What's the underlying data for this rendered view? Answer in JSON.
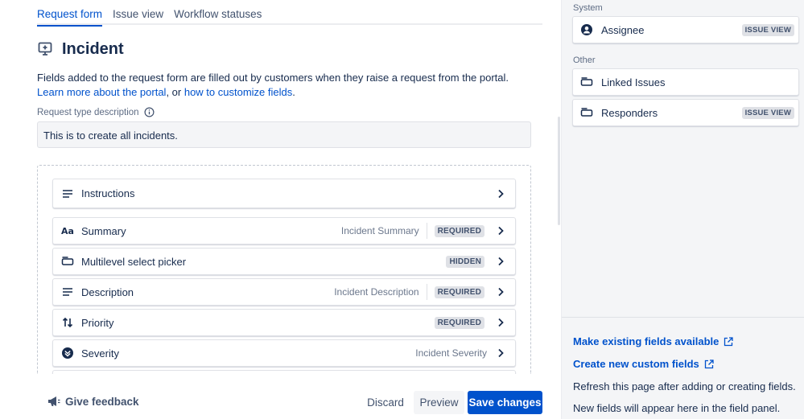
{
  "tabs": [
    {
      "label": "Request form",
      "active": true
    },
    {
      "label": "Issue view",
      "active": false
    },
    {
      "label": "Workflow statuses",
      "active": false
    }
  ],
  "page": {
    "title": "Incident",
    "icon": "monitor-icon",
    "description_text": "Fields added to the request form are filled out by customers when they raise a request from the portal. ",
    "link1": "Learn more about the portal",
    "desc_mid": ", or ",
    "link2": "how to customize fields",
    "desc_end": "."
  },
  "request_type": {
    "label": "Request type description",
    "value": "This is to create all incidents."
  },
  "fields": [
    {
      "icon": "text-lines-icon",
      "label": "Instructions",
      "default": "",
      "badge": ""
    },
    {
      "icon": "text-format-icon",
      "label": "Summary",
      "default": "Incident Summary",
      "badge": "REQUIRED"
    },
    {
      "icon": "select-box-icon",
      "label": "Multilevel select picker",
      "default": "",
      "badge": "HIDDEN"
    },
    {
      "icon": "text-lines-icon",
      "label": "Description",
      "default": "Incident Description",
      "badge": "REQUIRED"
    },
    {
      "icon": "arrows-updown-icon",
      "label": "Priority",
      "default": "",
      "badge": "REQUIRED"
    },
    {
      "icon": "chevron-circle-icon",
      "label": "Severity",
      "default": "Incident Severity",
      "badge": ""
    }
  ],
  "footer": {
    "feedback": "Give feedback",
    "discard": "Discard",
    "preview": "Preview",
    "save": "Save changes"
  },
  "side": {
    "system_label": "System",
    "system_fields": [
      {
        "icon": "user-avatar-icon",
        "label": "Assignee",
        "badge": "ISSUE VIEW"
      }
    ],
    "other_label": "Other",
    "other_fields": [
      {
        "icon": "select-box-icon",
        "label": "Linked Issues",
        "badge": ""
      },
      {
        "icon": "select-box-icon",
        "label": "Responders",
        "badge": "ISSUE VIEW"
      }
    ],
    "link_existing": "Make existing fields available",
    "link_create": "Create new custom fields",
    "note1": "Refresh this page after adding or creating fields.",
    "note2": "New fields will appear here in the field panel."
  },
  "colors": {
    "accent": "#0052cc",
    "text": "#172b4d",
    "subtle": "#6b778c",
    "panel_bg": "#f4f5f7"
  }
}
